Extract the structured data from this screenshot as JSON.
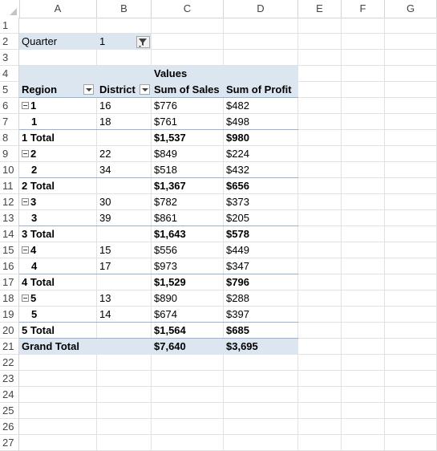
{
  "columns": [
    "A",
    "B",
    "C",
    "D",
    "E",
    "F",
    "G"
  ],
  "rows": [
    "1",
    "2",
    "3",
    "4",
    "5",
    "6",
    "7",
    "8",
    "9",
    "10",
    "11",
    "12",
    "13",
    "14",
    "15",
    "16",
    "17",
    "18",
    "19",
    "20",
    "21",
    "22",
    "23",
    "24",
    "25",
    "26",
    "27"
  ],
  "filter": {
    "label": "Quarter",
    "value": "1"
  },
  "header": {
    "values": "Values",
    "region": "Region",
    "district": "District",
    "sales": "Sum of Sales",
    "profit": "Sum of Profit"
  },
  "pivot": [
    {
      "a": "1",
      "b": "16",
      "c": "$776",
      "d": "$482",
      "kind": "group"
    },
    {
      "a": "1",
      "b": "18",
      "c": "$761",
      "d": "$498",
      "kind": "item"
    },
    {
      "a": "1 Total",
      "b": "",
      "c": "$1,537",
      "d": "$980",
      "kind": "total"
    },
    {
      "a": "2",
      "b": "22",
      "c": "$849",
      "d": "$224",
      "kind": "group"
    },
    {
      "a": "2",
      "b": "34",
      "c": "$518",
      "d": "$432",
      "kind": "item"
    },
    {
      "a": "2 Total",
      "b": "",
      "c": "$1,367",
      "d": "$656",
      "kind": "total"
    },
    {
      "a": "3",
      "b": "30",
      "c": "$782",
      "d": "$373",
      "kind": "group"
    },
    {
      "a": "3",
      "b": "39",
      "c": "$861",
      "d": "$205",
      "kind": "item"
    },
    {
      "a": "3 Total",
      "b": "",
      "c": "$1,643",
      "d": "$578",
      "kind": "total"
    },
    {
      "a": "4",
      "b": "15",
      "c": "$556",
      "d": "$449",
      "kind": "group"
    },
    {
      "a": "4",
      "b": "17",
      "c": "$973",
      "d": "$347",
      "kind": "item"
    },
    {
      "a": "4 Total",
      "b": "",
      "c": "$1,529",
      "d": "$796",
      "kind": "total"
    },
    {
      "a": "5",
      "b": "13",
      "c": "$890",
      "d": "$288",
      "kind": "group"
    },
    {
      "a": "5",
      "b": "14",
      "c": "$674",
      "d": "$397",
      "kind": "item"
    },
    {
      "a": "5 Total",
      "b": "",
      "c": "$1,564",
      "d": "$685",
      "kind": "total"
    }
  ],
  "grand_total": {
    "label": "Grand Total",
    "sales": "$7,640",
    "profit": "$3,695"
  },
  "colors": {
    "pivot_header_fill": "#dce6f1",
    "pivot_rule": "#95b3d7",
    "grid": "#e2e2e2"
  }
}
